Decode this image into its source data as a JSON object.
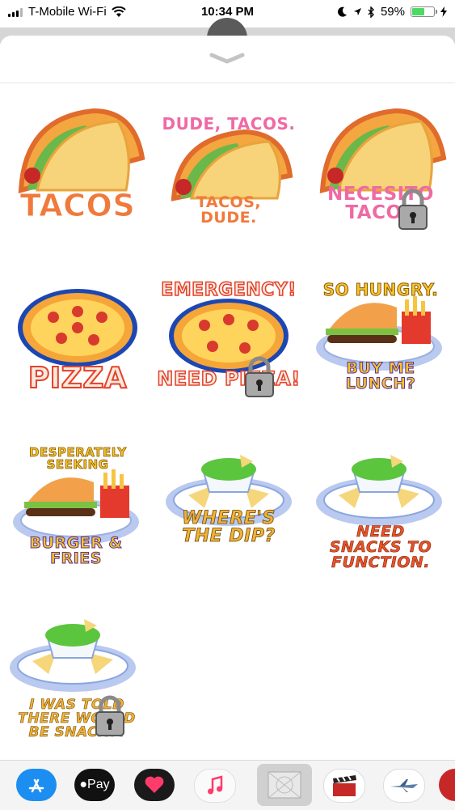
{
  "status_bar": {
    "carrier": "T-Mobile Wi-Fi",
    "time": "10:34 PM",
    "battery_percent": "59%",
    "battery_level": 0.59,
    "icons": [
      "signal-icon",
      "wifi-icon",
      "moon-icon",
      "location-icon",
      "bluetooth-icon",
      "battery-icon",
      "charging-icon"
    ]
  },
  "sheet": {
    "collapse_icon": "chevron-down-icon"
  },
  "stickers": [
    {
      "name": "tacos",
      "top_text": "",
      "bottom_text": "TACOS",
      "locked": false
    },
    {
      "name": "dude-tacos",
      "top_text": "DUDE, TACOS.",
      "bottom_text": "TACOS, DUDE.",
      "locked": false
    },
    {
      "name": "necesito-tacos",
      "top_text": "",
      "bottom_text": "NECESITO TACOS",
      "locked": true
    },
    {
      "name": "pizza",
      "top_text": "",
      "bottom_text": "PIZZA",
      "locked": false
    },
    {
      "name": "emergency-pizza",
      "top_text": "EMERGENCY!",
      "bottom_text": "NEED PIZZA!",
      "locked": true
    },
    {
      "name": "so-hungry",
      "top_text": "SO HUNGRY.",
      "bottom_text": "BUY ME LUNCH?",
      "locked": false
    },
    {
      "name": "burger-fries",
      "top_text": "DESPERATELY SEEKING",
      "bottom_text": "BURGER & FRIES",
      "locked": false
    },
    {
      "name": "wheres-the-dip",
      "top_text": "",
      "bottom_text": "WHERE'S THE DIP?",
      "locked": false
    },
    {
      "name": "need-snacks",
      "top_text": "",
      "bottom_text": "NEED SNACKS TO FUNCTION.",
      "locked": false
    },
    {
      "name": "told-snacks",
      "top_text": "",
      "bottom_text": "I WAS TOLD THERE WOULD BE SNACKS.",
      "locked": true
    }
  ],
  "dock": {
    "apps": [
      "app-store-icon",
      "apple-pay-icon",
      "digital-touch-icon",
      "music-icon",
      "sticker-pack-icon",
      "movie-clapper-icon",
      "airplane-icon",
      "partial-app-icon"
    ],
    "apple_pay_label": "Pay"
  }
}
